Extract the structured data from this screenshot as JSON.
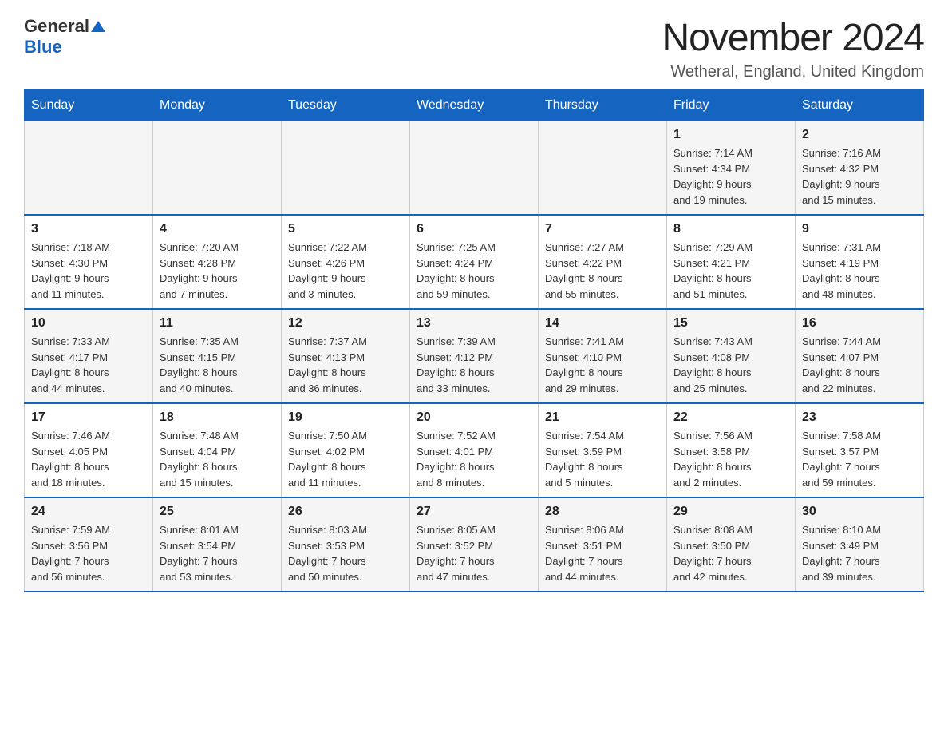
{
  "header": {
    "logo": {
      "general": "General",
      "blue": "Blue"
    },
    "title": "November 2024",
    "subtitle": "Wetheral, England, United Kingdom"
  },
  "columns": [
    "Sunday",
    "Monday",
    "Tuesday",
    "Wednesday",
    "Thursday",
    "Friday",
    "Saturday"
  ],
  "rows": [
    [
      {
        "day": "",
        "info": ""
      },
      {
        "day": "",
        "info": ""
      },
      {
        "day": "",
        "info": ""
      },
      {
        "day": "",
        "info": ""
      },
      {
        "day": "",
        "info": ""
      },
      {
        "day": "1",
        "info": "Sunrise: 7:14 AM\nSunset: 4:34 PM\nDaylight: 9 hours\nand 19 minutes."
      },
      {
        "day": "2",
        "info": "Sunrise: 7:16 AM\nSunset: 4:32 PM\nDaylight: 9 hours\nand 15 minutes."
      }
    ],
    [
      {
        "day": "3",
        "info": "Sunrise: 7:18 AM\nSunset: 4:30 PM\nDaylight: 9 hours\nand 11 minutes."
      },
      {
        "day": "4",
        "info": "Sunrise: 7:20 AM\nSunset: 4:28 PM\nDaylight: 9 hours\nand 7 minutes."
      },
      {
        "day": "5",
        "info": "Sunrise: 7:22 AM\nSunset: 4:26 PM\nDaylight: 9 hours\nand 3 minutes."
      },
      {
        "day": "6",
        "info": "Sunrise: 7:25 AM\nSunset: 4:24 PM\nDaylight: 8 hours\nand 59 minutes."
      },
      {
        "day": "7",
        "info": "Sunrise: 7:27 AM\nSunset: 4:22 PM\nDaylight: 8 hours\nand 55 minutes."
      },
      {
        "day": "8",
        "info": "Sunrise: 7:29 AM\nSunset: 4:21 PM\nDaylight: 8 hours\nand 51 minutes."
      },
      {
        "day": "9",
        "info": "Sunrise: 7:31 AM\nSunset: 4:19 PM\nDaylight: 8 hours\nand 48 minutes."
      }
    ],
    [
      {
        "day": "10",
        "info": "Sunrise: 7:33 AM\nSunset: 4:17 PM\nDaylight: 8 hours\nand 44 minutes."
      },
      {
        "day": "11",
        "info": "Sunrise: 7:35 AM\nSunset: 4:15 PM\nDaylight: 8 hours\nand 40 minutes."
      },
      {
        "day": "12",
        "info": "Sunrise: 7:37 AM\nSunset: 4:13 PM\nDaylight: 8 hours\nand 36 minutes."
      },
      {
        "day": "13",
        "info": "Sunrise: 7:39 AM\nSunset: 4:12 PM\nDaylight: 8 hours\nand 33 minutes."
      },
      {
        "day": "14",
        "info": "Sunrise: 7:41 AM\nSunset: 4:10 PM\nDaylight: 8 hours\nand 29 minutes."
      },
      {
        "day": "15",
        "info": "Sunrise: 7:43 AM\nSunset: 4:08 PM\nDaylight: 8 hours\nand 25 minutes."
      },
      {
        "day": "16",
        "info": "Sunrise: 7:44 AM\nSunset: 4:07 PM\nDaylight: 8 hours\nand 22 minutes."
      }
    ],
    [
      {
        "day": "17",
        "info": "Sunrise: 7:46 AM\nSunset: 4:05 PM\nDaylight: 8 hours\nand 18 minutes."
      },
      {
        "day": "18",
        "info": "Sunrise: 7:48 AM\nSunset: 4:04 PM\nDaylight: 8 hours\nand 15 minutes."
      },
      {
        "day": "19",
        "info": "Sunrise: 7:50 AM\nSunset: 4:02 PM\nDaylight: 8 hours\nand 11 minutes."
      },
      {
        "day": "20",
        "info": "Sunrise: 7:52 AM\nSunset: 4:01 PM\nDaylight: 8 hours\nand 8 minutes."
      },
      {
        "day": "21",
        "info": "Sunrise: 7:54 AM\nSunset: 3:59 PM\nDaylight: 8 hours\nand 5 minutes."
      },
      {
        "day": "22",
        "info": "Sunrise: 7:56 AM\nSunset: 3:58 PM\nDaylight: 8 hours\nand 2 minutes."
      },
      {
        "day": "23",
        "info": "Sunrise: 7:58 AM\nSunset: 3:57 PM\nDaylight: 7 hours\nand 59 minutes."
      }
    ],
    [
      {
        "day": "24",
        "info": "Sunrise: 7:59 AM\nSunset: 3:56 PM\nDaylight: 7 hours\nand 56 minutes."
      },
      {
        "day": "25",
        "info": "Sunrise: 8:01 AM\nSunset: 3:54 PM\nDaylight: 7 hours\nand 53 minutes."
      },
      {
        "day": "26",
        "info": "Sunrise: 8:03 AM\nSunset: 3:53 PM\nDaylight: 7 hours\nand 50 minutes."
      },
      {
        "day": "27",
        "info": "Sunrise: 8:05 AM\nSunset: 3:52 PM\nDaylight: 7 hours\nand 47 minutes."
      },
      {
        "day": "28",
        "info": "Sunrise: 8:06 AM\nSunset: 3:51 PM\nDaylight: 7 hours\nand 44 minutes."
      },
      {
        "day": "29",
        "info": "Sunrise: 8:08 AM\nSunset: 3:50 PM\nDaylight: 7 hours\nand 42 minutes."
      },
      {
        "day": "30",
        "info": "Sunrise: 8:10 AM\nSunset: 3:49 PM\nDaylight: 7 hours\nand 39 minutes."
      }
    ]
  ]
}
